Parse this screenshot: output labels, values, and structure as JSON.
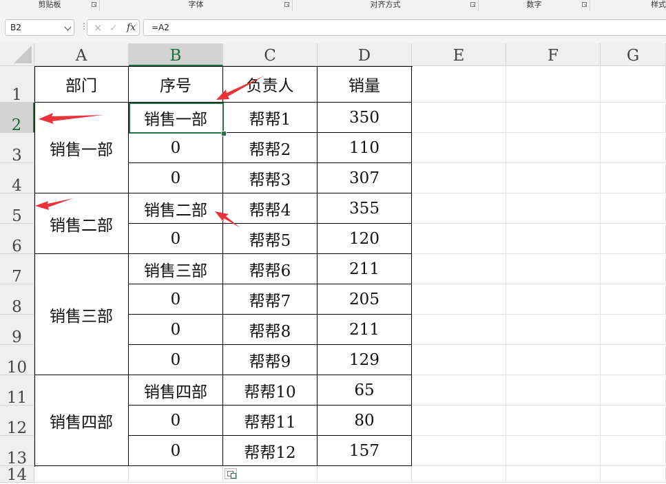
{
  "ribbon": {
    "groups": [
      "剪贴板",
      "字体",
      "对齐方式",
      "数字",
      "样式"
    ]
  },
  "formula_bar": {
    "name_box": "B2",
    "cancel_icon": "✕",
    "enter_icon": "✓",
    "fx_label": "fx",
    "formula": "=A2"
  },
  "columns": [
    "A",
    "B",
    "C",
    "D",
    "E",
    "F",
    "G"
  ],
  "rows": [
    "1",
    "2",
    "3",
    "4",
    "5",
    "6",
    "7",
    "8",
    "9",
    "10",
    "11",
    "12",
    "13",
    "14"
  ],
  "selection": {
    "cell": "B2",
    "column": "B",
    "row": "2"
  },
  "sheet": {
    "headers": [
      "部门",
      "序号",
      "负责人",
      "销量"
    ],
    "departments": [
      "销售一部",
      "销售二部",
      "销售三部",
      "销售四部"
    ],
    "seq": [
      "销售一部",
      "0",
      "0",
      "销售二部",
      "0",
      "销售三部",
      "0",
      "0",
      "0",
      "销售四部",
      "0",
      "0"
    ],
    "owners": [
      "帮帮1",
      "帮帮2",
      "帮帮3",
      "帮帮4",
      "帮帮5",
      "帮帮6",
      "帮帮7",
      "帮帮8",
      "帮帮9",
      "帮帮10",
      "帮帮11",
      "帮帮12"
    ],
    "sales": [
      "350",
      "110",
      "307",
      "355",
      "120",
      "211",
      "205",
      "211",
      "129",
      "65",
      "80",
      "157"
    ]
  },
  "colors": {
    "accent_green": "#217346",
    "arrow_red": "#e8333a",
    "header_bg": "#efefef",
    "ribbon_bg": "#f3f3f3"
  },
  "icons": {
    "namebox_dropdown": "chevron-down-icon",
    "cancel": "cancel-icon",
    "enter": "check-icon",
    "function": "fx-icon",
    "paste_options": "paste-options-icon"
  }
}
